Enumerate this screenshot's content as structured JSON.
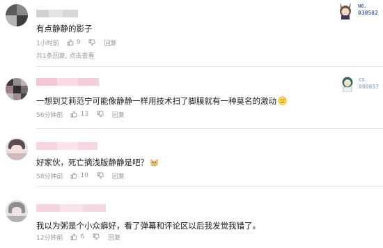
{
  "comments": [
    {
      "content": "有点静静的影子",
      "time": "1小时前",
      "likes": "9",
      "reply_label": "回复",
      "replies_summary": "共1条回复, ",
      "replies_view": "点击查看",
      "badge_label": "NO.",
      "badge_number": "030582"
    },
    {
      "content": "一想到艾莉范宁可能像静静一样用技术扫了脚膜就有一种莫名的激动",
      "time": "56分钟前",
      "likes": "13",
      "reply_label": "回复",
      "badge_label": "CO.",
      "badge_number": "000637"
    },
    {
      "content": "好家伙，死亡摘浅版静静是吧？",
      "time": "58分钟前",
      "likes": "10",
      "reply_label": "回复"
    },
    {
      "content": "我以为粥是个小众癖好，看了弹幕和评论区以后我发觉我错了。",
      "time": "12分钟前",
      "likes": "6",
      "reply_label": "回复"
    }
  ],
  "colors": {
    "text": "#18191c",
    "meta": "#9499a0",
    "divider": "#e3e5e7",
    "username_pink": "#fb7299"
  },
  "icons": {
    "like": "thumb-up-icon",
    "dislike": "thumb-down-icon",
    "emoji_awkward": "sweat-smile-emoji",
    "emoji_cat": "cat-emoji"
  }
}
